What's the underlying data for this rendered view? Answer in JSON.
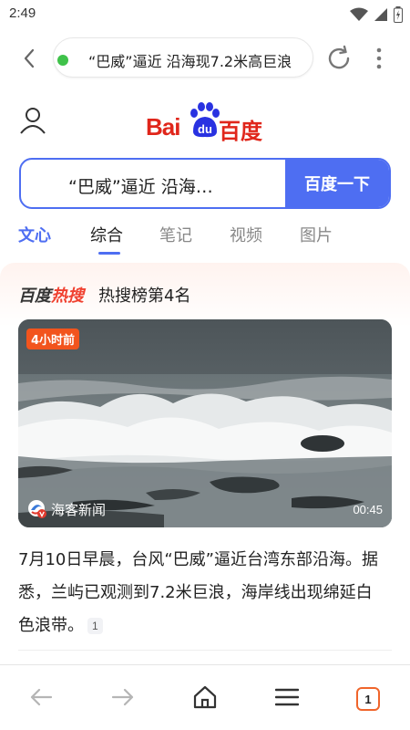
{
  "status_bar": {
    "time": "2:49"
  },
  "browser": {
    "url_text": "“巴威”逼近 沿海现7.2米高巨浪",
    "tab_count": "1"
  },
  "baidu": {
    "logo_bai": "Bai",
    "logo_du": "du",
    "logo_cn": "百度",
    "search_query": "“巴威”逼近 沿海…",
    "search_button": "百度一下"
  },
  "tabs": [
    {
      "label": "文心"
    },
    {
      "label": "综合"
    },
    {
      "label": "笔记"
    },
    {
      "label": "视频"
    },
    {
      "label": "图片"
    }
  ],
  "hot": {
    "brand_a": "百度",
    "brand_b": "热搜",
    "rank": "热搜榜第4名"
  },
  "video": {
    "time_ago": "4小时前",
    "source": "海客新闻",
    "duration": "00:45"
  },
  "article": {
    "text": "7月10日早晨，台风“巴威”逼近台湾东部沿海。据悉，兰屿已观测到7.2米巨浪，海岸线出现绵延白色浪带。",
    "citation": "1"
  },
  "colors": {
    "accent": "#4e6ef2",
    "baidu_red": "#e0261b",
    "badge": "#f2541d",
    "tab_border": "#f0652b"
  }
}
